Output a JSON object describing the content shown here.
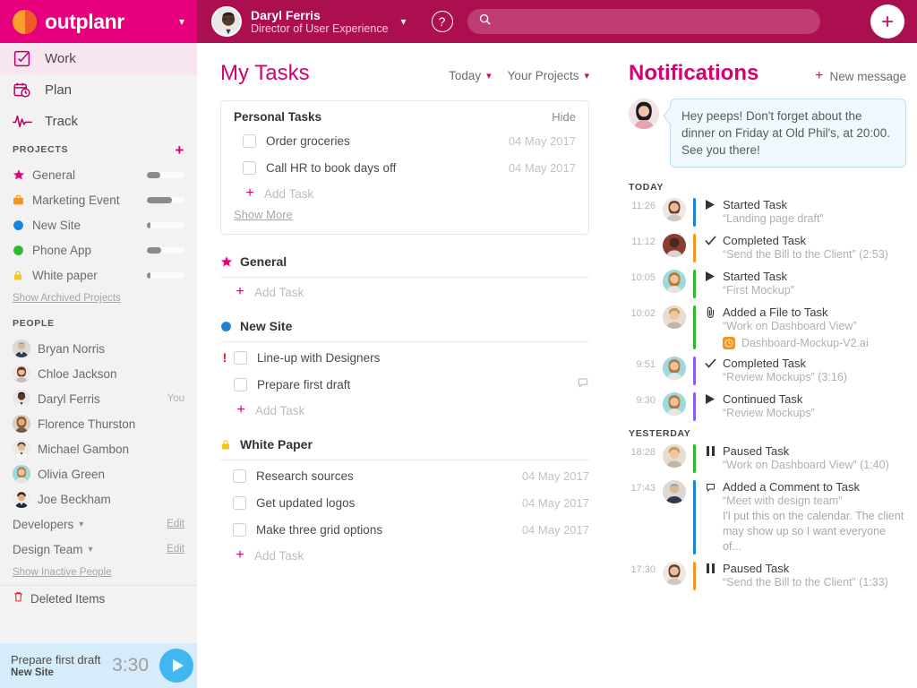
{
  "brand": {
    "name": "outplanr",
    "logo_chevron": "chevron-down",
    "pink": "#e6007e",
    "crimson": "#ac0f50",
    "accent": "#d6006e"
  },
  "sidebar": {
    "nav": [
      {
        "label": "Work",
        "icon": "checklist-icon",
        "active": true
      },
      {
        "label": "Plan",
        "icon": "calendar-clock-icon",
        "active": false
      },
      {
        "label": "Track",
        "icon": "pulse-icon",
        "active": false
      }
    ],
    "projects_header": "PROJECTS",
    "add_project": "+",
    "projects": [
      {
        "label": "General",
        "icon": "star-icon",
        "color": "#e6007e",
        "progress": 35
      },
      {
        "label": "Marketing Event",
        "icon": "briefcase-icon",
        "color": "#f7941e",
        "progress": 66
      },
      {
        "label": "New Site",
        "icon": "dot-icon",
        "color": "#1a84d8",
        "progress": 6
      },
      {
        "label": "Phone App",
        "icon": "dot-icon",
        "color": "#2eb82e",
        "progress": 38
      },
      {
        "label": "White paper",
        "icon": "lock-icon",
        "color": "#f5c518",
        "progress": 6
      }
    ],
    "show_archived": "Show Archived Projects",
    "people_header": "PEOPLE",
    "people": [
      {
        "name": "Bryan Norris",
        "you": ""
      },
      {
        "name": "Chloe Jackson",
        "you": ""
      },
      {
        "name": "Daryl Ferris",
        "you": "You"
      },
      {
        "name": "Florence Thurston",
        "you": ""
      },
      {
        "name": "Michael Gambon",
        "you": ""
      },
      {
        "name": "Olivia Green",
        "you": ""
      },
      {
        "name": "Joe Beckham",
        "you": ""
      }
    ],
    "teams": [
      {
        "name": "Developers",
        "edit": "Edit"
      },
      {
        "name": "Design Team",
        "edit": "Edit"
      }
    ],
    "show_inactive": "Show Inactive People",
    "deleted_items": "Deleted Items",
    "timer": {
      "task": "Prepare first draft",
      "project": "New Site",
      "elapsed": "3:30",
      "play_icon": "play-icon"
    }
  },
  "topbar": {
    "user_name": "Daryl Ferris",
    "user_role": "Director of User Experience",
    "user_chevron": "chevron-down",
    "help": "?",
    "search_placeholder": "",
    "search_value": "",
    "search_icon": "search-icon",
    "add_icon": "plus-icon"
  },
  "tasks": {
    "title": "My Tasks",
    "filters": [
      {
        "label": "Today"
      },
      {
        "label": "Your Projects"
      }
    ],
    "personal": {
      "title": "Personal Tasks",
      "hide": "Hide",
      "items": [
        {
          "name": "Order groceries",
          "date": "04 May 2017",
          "priority": false,
          "comment": false
        },
        {
          "name": "Call HR to book days off",
          "date": "04 May 2017",
          "priority": false,
          "comment": false
        }
      ],
      "add_task": "Add Task",
      "show_more": "Show More"
    },
    "groups": [
      {
        "name": "General",
        "icon": "star-icon",
        "color": "#e6007e",
        "items": [],
        "add_task": "Add Task"
      },
      {
        "name": "New Site",
        "icon": "dot-icon",
        "color": "#1a84d8",
        "items": [
          {
            "name": "Line-up with Designers",
            "date": "",
            "priority": true,
            "comment": false
          },
          {
            "name": "Prepare first draft",
            "date": "",
            "priority": false,
            "comment": true
          }
        ],
        "add_task": "Add Task"
      },
      {
        "name": "White Paper",
        "icon": "lock-icon",
        "color": "#f5c518",
        "items": [
          {
            "name": "Research sources",
            "date": "04 May 2017",
            "priority": false,
            "comment": false
          },
          {
            "name": "Get updated logos",
            "date": "04 May 2017",
            "priority": false,
            "comment": false
          },
          {
            "name": "Make three grid options",
            "date": "04 May 2017",
            "priority": false,
            "comment": false
          }
        ],
        "add_task": "Add Task"
      }
    ]
  },
  "notifications": {
    "title": "Notifications",
    "new_message": "New message",
    "message": {
      "text": "Hey peeps! Don't forget about the dinner on Friday at Old Phil's, at 20:00. See you there!",
      "avatar": "olivia-avatar"
    },
    "sections": [
      {
        "label": "TODAY",
        "items": [
          {
            "time": "11:26",
            "icon": "play-icon",
            "action": "Started Task",
            "subject": "“Landing page draft”",
            "bar": "#1a84d8",
            "avatar": "chloe",
            "file": null,
            "comment": null
          },
          {
            "time": "11:12",
            "icon": "check-icon",
            "action": "Completed Task",
            "subject": "“Send the Bill to the Client” (2:53)",
            "bar": "#f7941e",
            "avatar": "bryan2",
            "file": null,
            "comment": null
          },
          {
            "time": "10:05",
            "icon": "play-icon",
            "action": "Started Task",
            "subject": "“First Mockup”",
            "bar": "#2eb82e",
            "avatar": "olivia",
            "file": null,
            "comment": null
          },
          {
            "time": "10:02",
            "icon": "paperclip-icon",
            "action": "Added a File to Task",
            "subject": "“Work on Dashboard View”",
            "bar": "#2eb82e",
            "avatar": "michael",
            "file": "Dashboard-Mockup-V2.ai",
            "comment": null
          },
          {
            "time": "9:51",
            "icon": "check-icon",
            "action": "Completed Task",
            "subject": "“Review Mockups” (3:16)",
            "bar": "#8b5cf6",
            "avatar": "olivia",
            "file": null,
            "comment": null
          },
          {
            "time": "9:30",
            "icon": "play-icon",
            "action": "Continued Task",
            "subject": "“Review Mockups”",
            "bar": "#8b5cf6",
            "avatar": "olivia",
            "file": null,
            "comment": null
          }
        ]
      },
      {
        "label": "YESTERDAY",
        "items": [
          {
            "time": "18:28",
            "icon": "pause-icon",
            "action": "Paused Task",
            "subject": "“Work on Dashboard View” (1:40)",
            "bar": "#2eb82e",
            "avatar": "michael",
            "file": null,
            "comment": null
          },
          {
            "time": "17:43",
            "icon": "comment-icon",
            "action": "Added a Comment to Task",
            "subject": "“Meet with design team”",
            "bar": "#1a84d8",
            "avatar": "bryan",
            "file": null,
            "comment": "I'l put this on the calendar. The client may show up so I want everyone of..."
          },
          {
            "time": "17:30",
            "icon": "pause-icon",
            "action": "Paused Task",
            "subject": "“Send the Bill to the Client” (1:33)",
            "bar": "#f7941e",
            "avatar": "chloe",
            "file": null,
            "comment": null
          }
        ]
      }
    ]
  }
}
